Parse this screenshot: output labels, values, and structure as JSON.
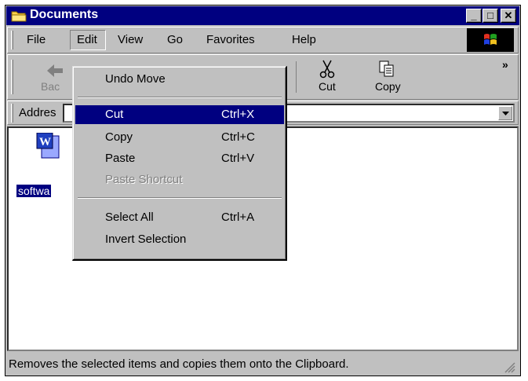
{
  "window": {
    "title": "Documents"
  },
  "caption_buttons": {
    "minimize": "_",
    "maximize": "□",
    "close": "✕"
  },
  "menubar": {
    "file": "File",
    "edit": "Edit",
    "view": "View",
    "go": "Go",
    "favorites": "Favorites",
    "help": "Help"
  },
  "toolbar": {
    "back": "Bac",
    "cut": "Cut",
    "copy": "Copy",
    "more": "»"
  },
  "address": {
    "label": "Addres"
  },
  "content": {
    "file_name": "softwa"
  },
  "edit_menu": {
    "undo": "Undo Move",
    "cut": "Cut",
    "cut_accel": "Ctrl+X",
    "copy": "Copy",
    "copy_accel": "Ctrl+C",
    "paste": "Paste",
    "paste_accel": "Ctrl+V",
    "paste_shortcut": "Paste Shortcut",
    "select_all": "Select All",
    "select_all_accel": "Ctrl+A",
    "invert_selection": "Invert Selection"
  },
  "status": {
    "text": "Removes the selected items and copies them onto the Clipboard."
  },
  "colors": {
    "titlebar": "#000080",
    "face": "#c0c0c0",
    "highlight": "#000080"
  },
  "icons": [
    "folder-icon",
    "windows-logo-icon",
    "back-arrow-icon",
    "scissors-icon",
    "copy-icon",
    "word-document-icon",
    "dropdown-arrow-icon",
    "size-grip-icon"
  ]
}
